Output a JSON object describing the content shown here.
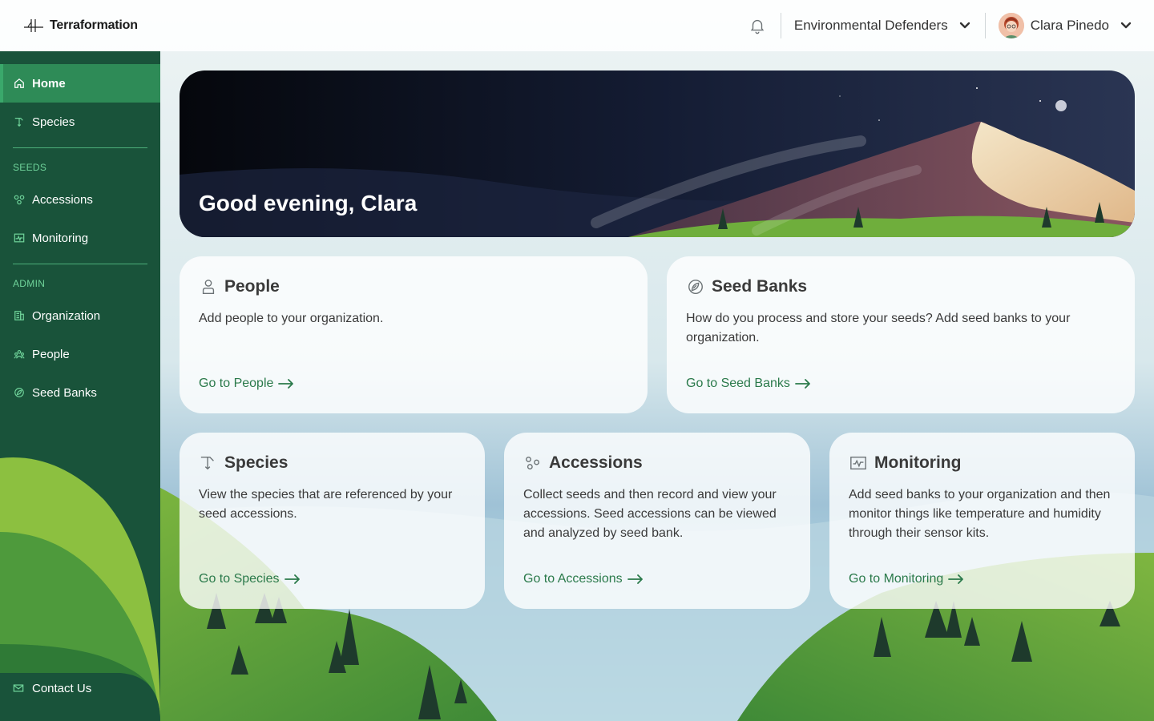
{
  "header": {
    "logo_text": "Terraformation",
    "organization": "Environmental Defenders",
    "user_name": "Clara Pinedo"
  },
  "sidebar": {
    "items": [
      {
        "label": "Home",
        "icon": "home-icon",
        "active": true
      },
      {
        "label": "Species",
        "icon": "species-icon"
      }
    ],
    "seeds_section": "SEEDS",
    "seeds_items": [
      {
        "label": "Accessions",
        "icon": "accessions-icon"
      },
      {
        "label": "Monitoring",
        "icon": "monitoring-icon"
      }
    ],
    "admin_section": "ADMIN",
    "admin_items": [
      {
        "label": "Organization",
        "icon": "organization-icon"
      },
      {
        "label": "People",
        "icon": "people-icon"
      },
      {
        "label": "Seed Banks",
        "icon": "seed-bank-icon"
      }
    ],
    "contact_label": "Contact Us"
  },
  "hero": {
    "greeting": "Good evening, Clara"
  },
  "cards": {
    "people": {
      "title": "People",
      "description": "Add people to your organization.",
      "link": "Go to People"
    },
    "seed_banks": {
      "title": "Seed Banks",
      "description": "How do you process and store your seeds? Add seed banks to your organization.",
      "link": "Go to Seed Banks"
    },
    "species": {
      "title": "Species",
      "description": "View the species that are referenced by your seed accessions.",
      "link": "Go to Species"
    },
    "accessions": {
      "title": "Accessions",
      "description": "Collect seeds and then record and view your accessions. Seed accessions can be viewed and analyzed by seed bank.",
      "link": "Go to Accessions"
    },
    "monitoring": {
      "title": "Monitoring",
      "description": "Add seed banks to your organization and then monitor things like temperature and humidity through their sensor kits.",
      "link": "Go to Monitoring"
    }
  },
  "colors": {
    "sidebar_bg": "#19533a",
    "active_item": "#2e8b57",
    "link_green": "#2b7a4b",
    "section_label": "#6fd39a"
  }
}
